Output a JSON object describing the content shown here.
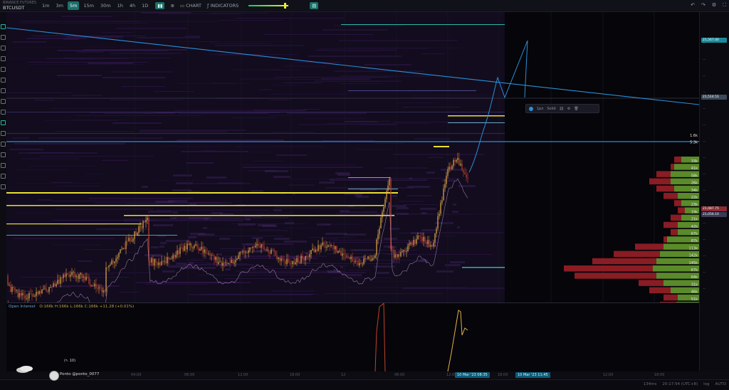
{
  "toolbar": {
    "exchange": "BINANCE FUTURES",
    "symbol": "BTCUSDT",
    "timeframes": [
      "1m",
      "3m",
      "5m",
      "15m",
      "30m",
      "1h",
      "4h",
      "1D"
    ],
    "active_timeframe": "5m",
    "chart_label": "CHART",
    "indicators_label": "INDICATORS",
    "slider_level": 0.92
  },
  "subtitle": "• 6",
  "oi_pane": {
    "name": "Open Interest",
    "values": "O:166k H:166k L:166k C:166k +11.28 (+0.01%)"
  },
  "price_axis": {
    "top_badge": "21,567.00",
    "mid_badge": "21,514.51",
    "low_badge_1": "21,087.75",
    "low_badge_2": "21,056.10",
    "volume_labels": [
      "1.6k",
      "5.3k",
      "33k",
      "41k",
      "58k",
      "26k",
      "34k",
      "22k",
      "23k",
      "19k",
      "21k",
      "42k",
      "67k",
      "87k",
      "113k",
      "142k",
      "145k",
      "67k",
      "64k",
      "31k",
      "46k",
      "51k",
      "33k"
    ]
  },
  "time_axis": {
    "labels": [
      "04:00",
      "06:00",
      "12:00",
      "18:00",
      "12",
      "06:00",
      "12:00",
      "18:00",
      "12:00",
      "18:00"
    ],
    "badges": [
      "10 Mar '23  08:35",
      "10 Mar '23  11:45"
    ]
  },
  "status_bar": {
    "zoom": "134ms",
    "clock": "20:17:54 (UTC+8)",
    "scale_log": "log",
    "scale_auto": "AUTO"
  },
  "draw_toolbar": {
    "width_label": "1px",
    "style_label": "Solid"
  },
  "watermark": {
    "name": "Ponto @ponto_0077",
    "cursor": "(↖ 10)"
  },
  "colors": {
    "background": "#0c0c12",
    "heatmap": "#3a1a5a",
    "candle_up": "#e8b048",
    "candle_down": "#c0432c",
    "liquidity_wall": "#e8e030",
    "trendline": "#2a8fd6",
    "sell_profile": "#8a1c24",
    "buy_profile": "#5a8a2a"
  }
}
